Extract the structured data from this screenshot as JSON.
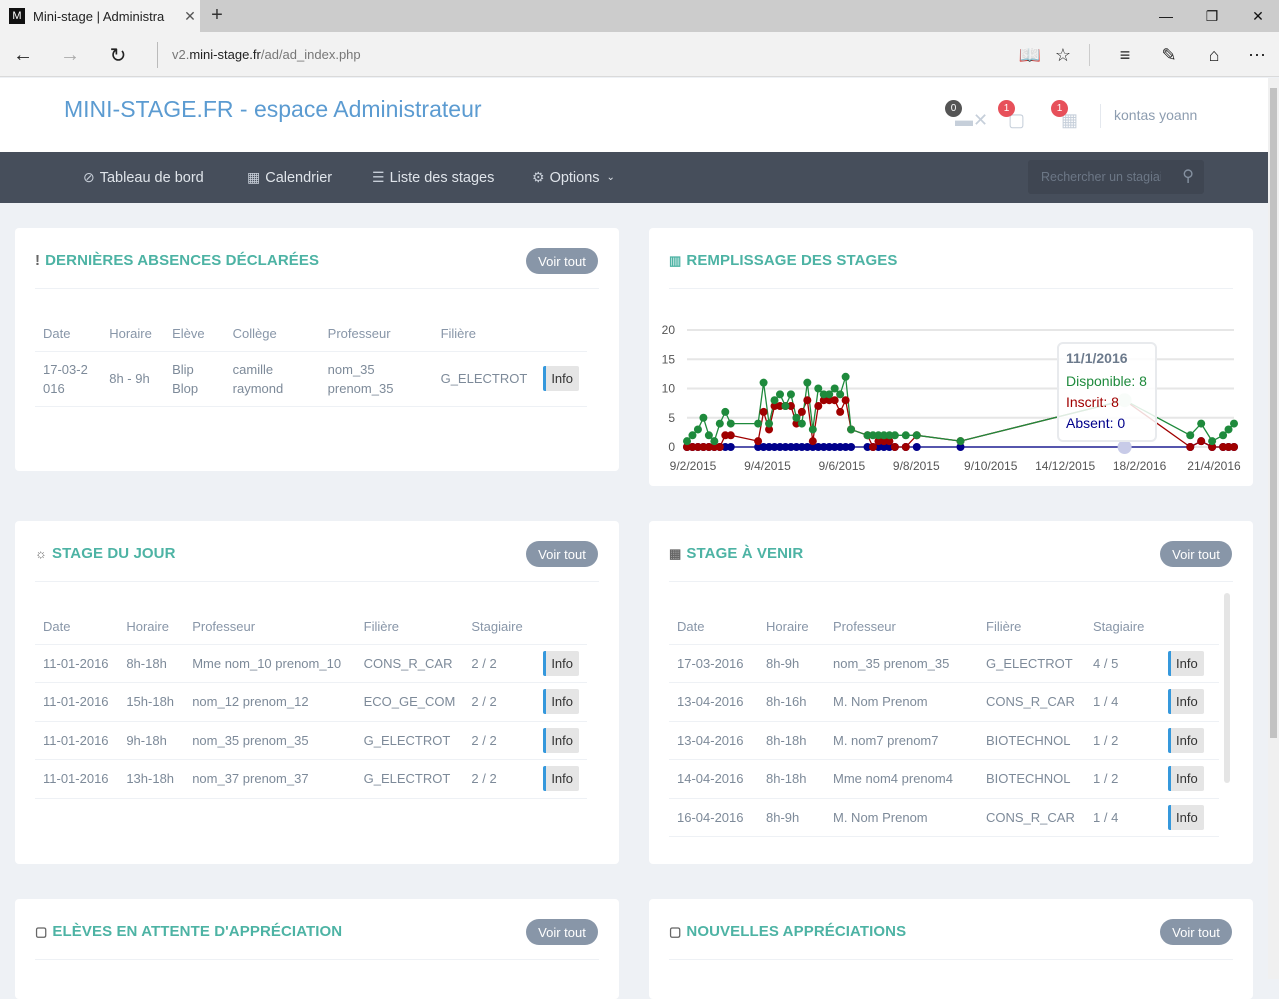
{
  "browser": {
    "tab_title": "Mini-stage | Administra",
    "tab_favicon": "M",
    "url_prefix": "v2.",
    "url_domain": "mini-stage.fr",
    "url_path": "/ad/ad_index.php",
    "icons": [
      "back-icon",
      "forward-icon",
      "refresh-icon",
      "reading-view-icon",
      "favorite-star-icon",
      "hub-icon",
      "web-note-icon",
      "share-icon",
      "more-icon"
    ]
  },
  "header": {
    "brand": "MINI-STAGE.FR - espace Administrateur",
    "notifications": [
      {
        "name": "absences",
        "count": "0",
        "color": "#555555"
      },
      {
        "name": "appreciations",
        "count": "1",
        "color": "#e7505a"
      },
      {
        "name": "calendar",
        "count": "1",
        "color": "#e7505a"
      }
    ],
    "user": "kontas yoann"
  },
  "nav": {
    "items": [
      {
        "label": "Tableau de bord",
        "icon": "compass-icon"
      },
      {
        "label": "Calendrier",
        "icon": "calendar-icon"
      },
      {
        "label": "Liste des stages",
        "icon": "list-icon"
      },
      {
        "label": "Options",
        "icon": "gear-icon"
      }
    ],
    "search_placeholder": "Rechercher un stagiaire"
  },
  "voir_tout": "Voir tout",
  "info_label": "Info",
  "absences": {
    "title": "DERNIÈRES ABSENCES DÉCLARÉES",
    "columns": [
      "Date",
      "Horaire",
      "Elève",
      "Collège",
      "Professeur",
      "Filière"
    ],
    "rows": [
      {
        "date": "17-03-2016",
        "horaire": "8h - 9h",
        "eleve": "Blip Blop",
        "college": "camille raymond",
        "professeur": "nom_35 prenom_35",
        "filiere": "G_ELECTROT"
      }
    ]
  },
  "remplissage": {
    "title": "REMPLISSAGE DES STAGES",
    "tooltip": {
      "date": "11/1/2016",
      "disponible": "Disponible: 8",
      "inscrit": "Inscrit: 8",
      "absent": "Absent: 0"
    }
  },
  "stage_jour": {
    "title": "STAGE DU JOUR",
    "columns": [
      "Date",
      "Horaire",
      "Professeur",
      "Filière",
      "Stagiaire"
    ],
    "rows": [
      {
        "date": "11-01-2016",
        "horaire": "8h-18h",
        "professeur": "Mme nom_10 prenom_10",
        "filiere": "CONS_R_CAR",
        "stagiaire": "2 / 2"
      },
      {
        "date": "11-01-2016",
        "horaire": "15h-18h",
        "professeur": "nom_12 prenom_12",
        "filiere": "ECO_GE_COM",
        "stagiaire": "2 / 2"
      },
      {
        "date": "11-01-2016",
        "horaire": "9h-18h",
        "professeur": "nom_35 prenom_35",
        "filiere": "G_ELECTROT",
        "stagiaire": "2 / 2"
      },
      {
        "date": "11-01-2016",
        "horaire": "13h-18h",
        "professeur": "nom_37 prenom_37",
        "filiere": "G_ELECTROT",
        "stagiaire": "2 / 2"
      }
    ]
  },
  "stage_venir": {
    "title": "STAGE À VENIR",
    "columns": [
      "Date",
      "Horaire",
      "Professeur",
      "Filière",
      "Stagiaire"
    ],
    "rows": [
      {
        "date": "17-03-2016",
        "horaire": "8h-9h",
        "professeur": "nom_35 prenom_35",
        "filiere": "G_ELECTROT",
        "stagiaire": "4 / 5"
      },
      {
        "date": "13-04-2016",
        "horaire": "8h-16h",
        "professeur": "M. Nom Prenom",
        "filiere": "CONS_R_CAR",
        "stagiaire": "1 / 4"
      },
      {
        "date": "13-04-2016",
        "horaire": "8h-18h",
        "professeur": "M. nom7 prenom7",
        "filiere": "BIOTECHNOL",
        "stagiaire": "1 / 2"
      },
      {
        "date": "14-04-2016",
        "horaire": "8h-18h",
        "professeur": "Mme nom4 prenom4",
        "filiere": "BIOTECHNOL",
        "stagiaire": "1 / 2"
      },
      {
        "date": "16-04-2016",
        "horaire": "8h-9h",
        "professeur": "M. Nom Prenom",
        "filiere": "CONS_R_CAR",
        "stagiaire": "1 / 4"
      }
    ]
  },
  "attente": {
    "title": "ELÈVES EN ATTENTE D'APPRÉCIATION"
  },
  "nouvelles": {
    "title": "NOUVELLES APPRÉCIATIONS"
  },
  "chart_data": {
    "type": "line",
    "title": "REMPLISSAGE DES STAGES",
    "xlabel": "",
    "ylabel": "",
    "ylim": [
      0,
      20
    ],
    "yticks": [
      0,
      5,
      10,
      15,
      20
    ],
    "xticks": [
      "9/2/2015",
      "9/4/2015",
      "9/6/2015",
      "9/8/2015",
      "9/10/2015",
      "14/12/2015",
      "18/2/2016",
      "21/4/2016"
    ],
    "grid": true,
    "legend": "none",
    "x_index_range": [
      0,
      100
    ],
    "x": [
      0,
      1,
      2,
      3,
      4,
      5,
      6,
      7,
      8,
      13,
      14,
      15,
      16,
      17,
      18,
      19,
      20,
      21,
      22,
      23,
      24,
      25,
      26,
      27,
      28,
      29,
      30,
      33,
      34,
      35,
      36,
      37,
      38,
      40,
      42,
      50,
      80,
      92,
      94,
      96,
      98,
      99,
      100
    ],
    "series": [
      {
        "name": "Disponible",
        "color": "#1e8a3c",
        "values": [
          1,
          2,
          3,
          5,
          2,
          1,
          4,
          6,
          4,
          4,
          11,
          4,
          8,
          9,
          7,
          9,
          5,
          4,
          11,
          3,
          10,
          9,
          9,
          10,
          9,
          12,
          3,
          2,
          2,
          2,
          2,
          2,
          2,
          2,
          2,
          1,
          8,
          2,
          4,
          1,
          2,
          3,
          4
        ]
      },
      {
        "name": "Inscrit",
        "color": "#a00000",
        "values": [
          0,
          0,
          0,
          0,
          0,
          0,
          0,
          2,
          2,
          1,
          6,
          3,
          7,
          7,
          7,
          7,
          4,
          6,
          8,
          1,
          7,
          8,
          8,
          8,
          6,
          8,
          3,
          2,
          0,
          1,
          1,
          1,
          0,
          0,
          2,
          1,
          8,
          0,
          1,
          0,
          0,
          0,
          0
        ]
      },
      {
        "name": "Absent",
        "color": "#00008b",
        "values": [
          0,
          0,
          0,
          0,
          0,
          0,
          0,
          0,
          0,
          0,
          0,
          0,
          0,
          0,
          0,
          0,
          0,
          0,
          0,
          0,
          0,
          0,
          0,
          0,
          0,
          0,
          0,
          0,
          0,
          0,
          0,
          0,
          0,
          0,
          0,
          0,
          0,
          0,
          1,
          0,
          0,
          0,
          0
        ]
      }
    ],
    "highlight": {
      "date": "11/1/2016",
      "Disponible": 8,
      "Inscrit": 8,
      "Absent": 0
    }
  }
}
